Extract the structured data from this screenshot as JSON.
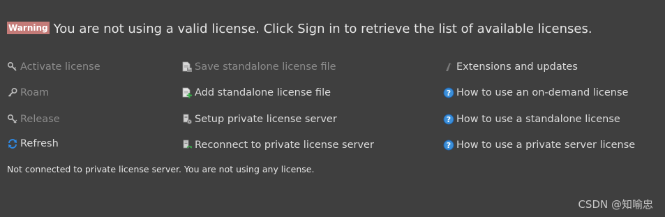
{
  "warning": {
    "badge": "Warning",
    "message": "You are not using a valid license. Click Sign in to retrieve the list of available licenses."
  },
  "actions": {
    "activate": {
      "label": "Activate license",
      "icon": "key-wrench-icon",
      "enabled": false
    },
    "roam": {
      "label": "Roam",
      "icon": "key-icon",
      "enabled": false
    },
    "release": {
      "label": "Release",
      "icon": "key-x-icon",
      "enabled": false
    },
    "refresh": {
      "label": "Refresh",
      "icon": "refresh-icon",
      "enabled": true
    },
    "save_file": {
      "label": "Save standalone license file",
      "icon": "save-document-icon",
      "enabled": false
    },
    "add_file": {
      "label": "Add standalone license file",
      "icon": "add-document-icon",
      "enabled": true
    },
    "setup_server": {
      "label": "Setup private license server",
      "icon": "server-gear-icon",
      "enabled": true
    },
    "reconnect_server": {
      "label": "Reconnect to private license server",
      "icon": "server-reconnect-icon",
      "enabled": true
    },
    "extensions": {
      "label": "Extensions and updates",
      "icon": "extensions-icon",
      "enabled": true
    },
    "help_on_demand": {
      "label": "How to use an on-demand license",
      "icon": "help-icon",
      "enabled": true
    },
    "help_standalone": {
      "label": "How to use a standalone license",
      "icon": "help-icon",
      "enabled": true
    },
    "help_private_server": {
      "label": "How to use a private server license",
      "icon": "help-icon",
      "enabled": true
    }
  },
  "status": {
    "text": "Not connected to private license server. You are not using any license."
  },
  "watermark": {
    "text": "CSDN @知喻忠"
  },
  "colors": {
    "background": "#3f3f3f",
    "warning_badge": "#c47b78",
    "disabled_text": "#8c8c8c",
    "enabled_text": "#dcdcdc",
    "help_blue": "#3b8fd9",
    "refresh_blue": "#2f8ae6"
  }
}
